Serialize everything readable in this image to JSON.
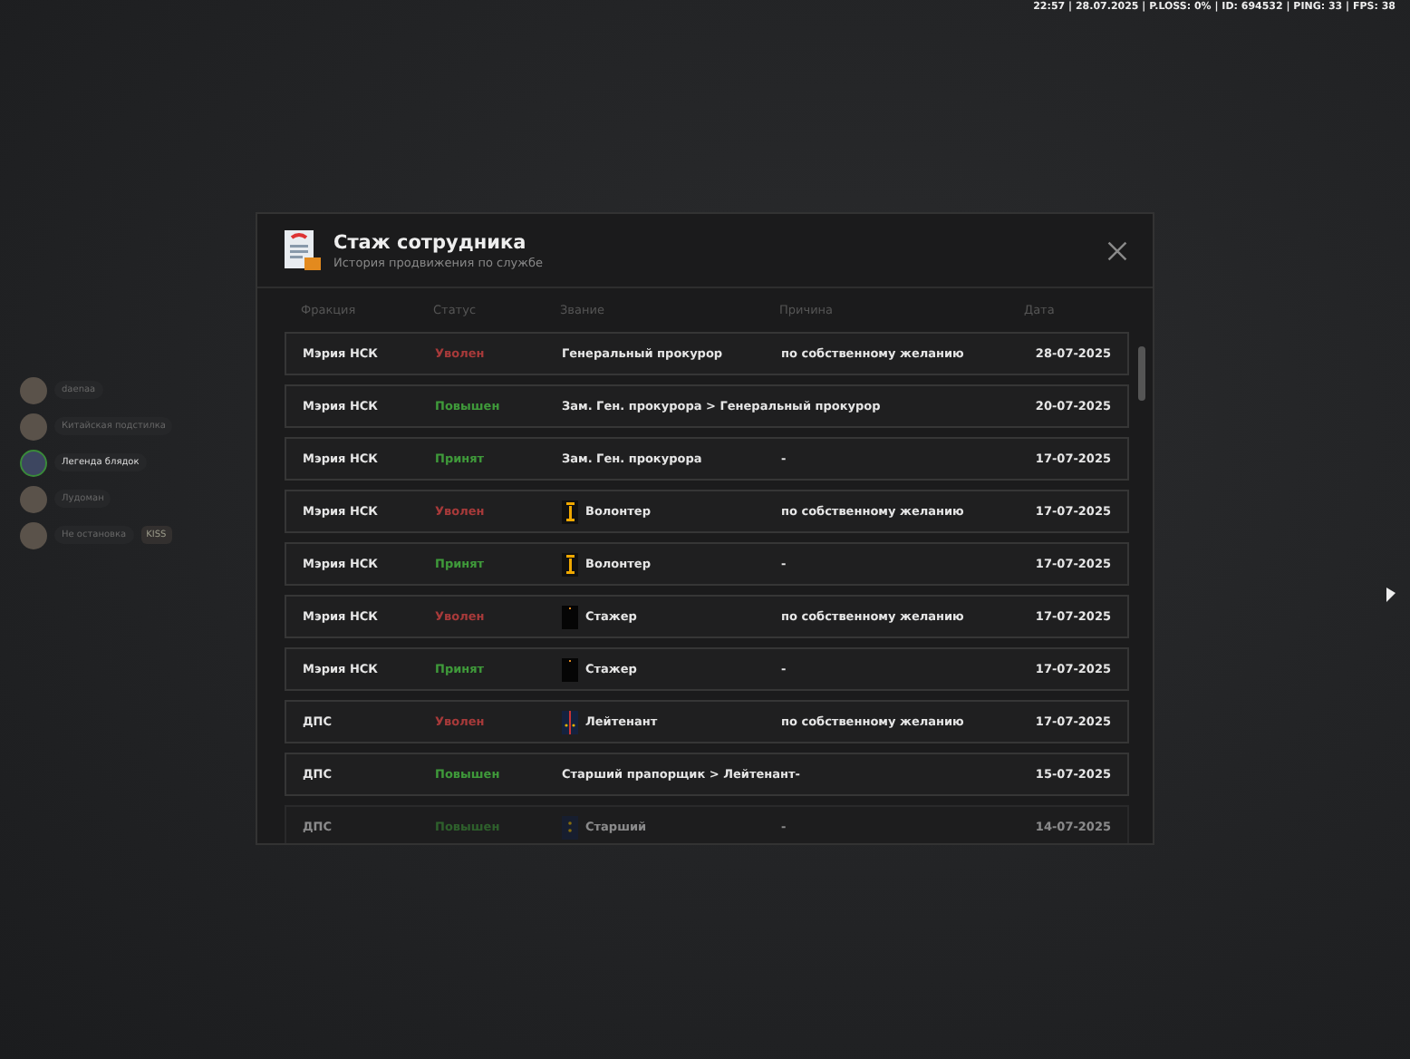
{
  "status_bar": "22:57 | 28.07.2025 | P.LOSS: 0% | ID: 694532 | PING: 33 | FPS: 38",
  "players": [
    {
      "name": "daenaa",
      "selected": false
    },
    {
      "name": "Китайская подстилка",
      "selected": false
    },
    {
      "name": "Легенда блядок",
      "selected": true
    },
    {
      "name": "Лудоман",
      "selected": false
    },
    {
      "name": "Не остановка",
      "selected": false,
      "tag": "KISS"
    }
  ],
  "modal": {
    "title": "Стаж сотрудника",
    "subtitle": "История продвижения по службе",
    "columns": [
      "Фракция",
      "Статус",
      "Звание",
      "Причина",
      "Дата"
    ],
    "rows": [
      {
        "faction": "Мэрия НСК",
        "status": "Уволен",
        "kind": "fired",
        "rank": "Генеральный прокурор",
        "reason": "по собственному желанию",
        "date": "28-07-2025"
      },
      {
        "faction": "Мэрия НСК",
        "status": "Повышен",
        "kind": "promoted",
        "rank": "Зам. Ген. прокурора > Генеральный прокурор",
        "date": "20-07-2025"
      },
      {
        "faction": "Мэрия НСК",
        "status": "Принят",
        "kind": "hired",
        "rank": "Зам. Ген. прокурора",
        "reason": "-",
        "date": "17-07-2025"
      },
      {
        "faction": "Мэрия НСК",
        "status": "Уволен",
        "kind": "fired",
        "rank": "Волонтер",
        "insignia": {
          "kind": "volunteer"
        },
        "reason": "по собственному желанию",
        "date": "17-07-2025"
      },
      {
        "faction": "Мэрия НСК",
        "status": "Принят",
        "kind": "hired",
        "rank": "Волонтер",
        "insignia": {
          "kind": "volunteer"
        },
        "reason": "-",
        "date": "17-07-2025"
      },
      {
        "faction": "Мэрия НСК",
        "status": "Уволен",
        "kind": "fired",
        "rank": "Стажер",
        "insignia": {
          "kind": "trainee"
        },
        "reason": "по собственному желанию",
        "date": "17-07-2025"
      },
      {
        "faction": "Мэрия НСК",
        "status": "Принят",
        "kind": "hired",
        "rank": "Стажер",
        "insignia": {
          "kind": "trainee"
        },
        "reason": "-",
        "date": "17-07-2025"
      },
      {
        "faction": "ДПС",
        "status": "Уволен",
        "kind": "fired",
        "rank": "Лейтенант",
        "insignia": {
          "kind": "lieutenant"
        },
        "reason": "по собственному желанию",
        "date": "17-07-2025"
      },
      {
        "faction": "ДПС",
        "status": "Повышен",
        "kind": "promoted",
        "rank": "Старший прапорщик > Лейтенант-",
        "date": "15-07-2025"
      },
      {
        "faction": "ДПС",
        "status": "Повышен",
        "kind": "promoted",
        "rank": "Старший",
        "insignia": {
          "kind": "senior"
        },
        "reason": "-",
        "date": "14-07-2025"
      }
    ]
  }
}
